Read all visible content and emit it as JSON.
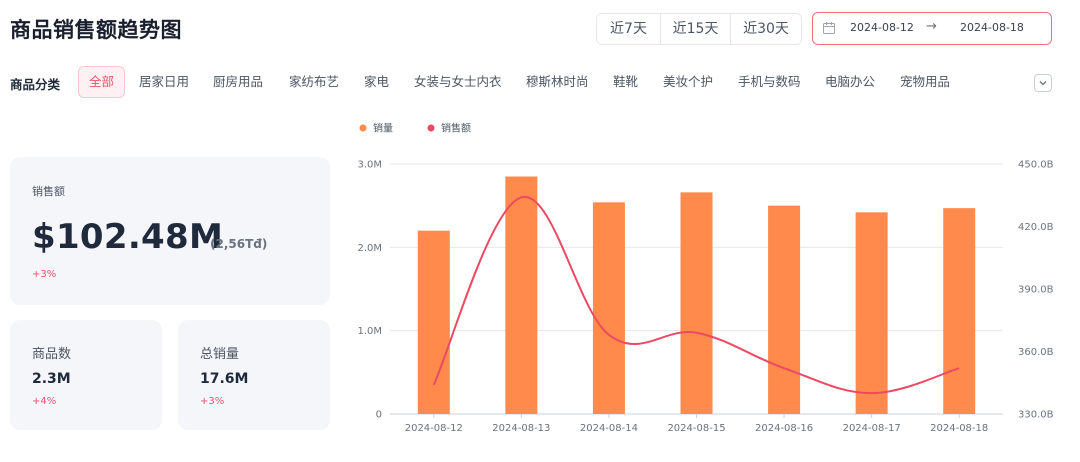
{
  "page": {
    "title": "商品销售额趋势图"
  },
  "range_tabs": [
    "近7天",
    "近15天",
    "近30天"
  ],
  "date_range": {
    "start": "2024-08-12",
    "separator": "→",
    "end": "2024-08-18"
  },
  "categories": {
    "label": "商品分类",
    "items": [
      "全部",
      "居家日用",
      "厨房用品",
      "家纺布艺",
      "家电",
      "女装与女士内衣",
      "穆斯林时尚",
      "鞋靴",
      "美妆个护",
      "手机与数码",
      "电脑办公",
      "宠物用品"
    ],
    "active_index": 0
  },
  "kpis": {
    "sales": {
      "label": "销售额",
      "value": "$102.48M",
      "sub": "(2,56Tđ)",
      "change": "+3%"
    },
    "products": {
      "label": "商品数",
      "value": "2.3M",
      "change": "+4%"
    },
    "volume": {
      "label": "总销量",
      "value": "17.6M",
      "change": "+3%"
    }
  },
  "colors": {
    "accent": "#f0506e",
    "bar": "#ff8a4c",
    "line": "#ec4a63"
  },
  "chart_data": {
    "type": "bar",
    "categories": [
      "2024-08-12",
      "2024-08-13",
      "2024-08-14",
      "2024-08-15",
      "2024-08-16",
      "2024-08-17",
      "2024-08-18"
    ],
    "series": [
      {
        "name": "销量",
        "type": "bar",
        "axis": "left",
        "values": [
          2.2,
          2.85,
          2.54,
          2.66,
          2.5,
          2.42,
          2.47
        ]
      },
      {
        "name": "销售额",
        "type": "line",
        "axis": "right",
        "values": [
          344,
          434,
          368,
          369,
          352,
          340,
          352
        ]
      }
    ],
    "y_left": {
      "ylim": [
        0,
        3
      ],
      "ticks": [
        "0",
        "1.0M",
        "2.0M",
        "3.0M"
      ],
      "tick_values": [
        0,
        1,
        2,
        3
      ]
    },
    "y_right": {
      "ylim": [
        330,
        450
      ],
      "ticks": [
        "330.0B",
        "360.0B",
        "390.0B",
        "420.0B",
        "450.0B"
      ],
      "tick_values": [
        330,
        360,
        390,
        420,
        450
      ]
    },
    "grid": true,
    "legend": "top-left"
  }
}
